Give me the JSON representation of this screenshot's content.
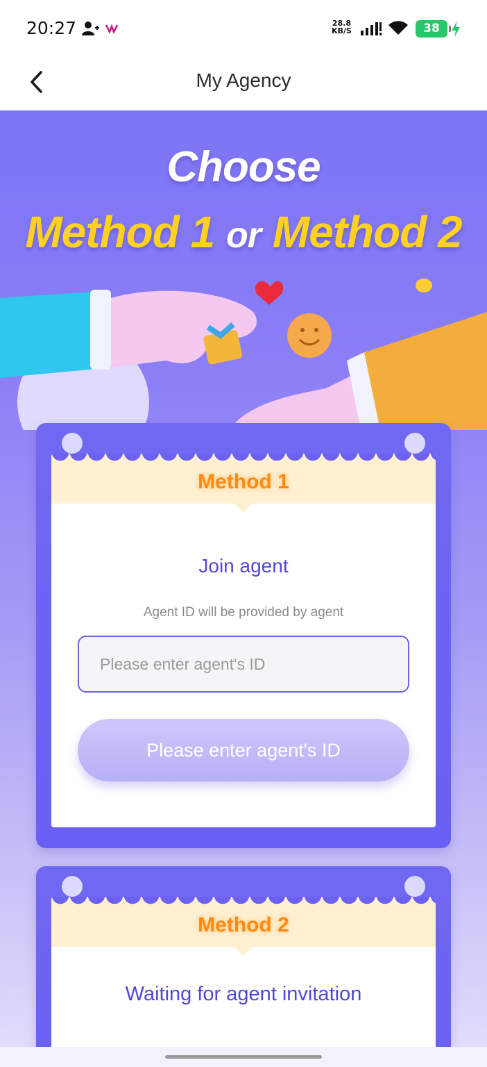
{
  "status_bar": {
    "time": "20:27",
    "net_speed_value": "28.8",
    "net_speed_unit": "KB/S",
    "battery": "38",
    "battery_color": "#27c86a"
  },
  "nav": {
    "title": "My Agency"
  },
  "hero": {
    "title": "Choose",
    "method1": "Method 1",
    "or": "or",
    "method2": "Method 2",
    "accent_color": "#ffd21f"
  },
  "method1": {
    "label": "Method 1",
    "heading": "Join agent",
    "hint": "Agent ID will be provided by agent",
    "input_placeholder": "Please enter agent's ID",
    "button_label": "Please enter agent's ID"
  },
  "method2": {
    "label": "Method 2",
    "heading": "Waiting for agent invitation"
  },
  "colors": {
    "card_purple": "#6c61f3",
    "heading_blue": "#5147d6",
    "header_orange": "#ff8a12",
    "header_bg": "#fff0d2"
  }
}
